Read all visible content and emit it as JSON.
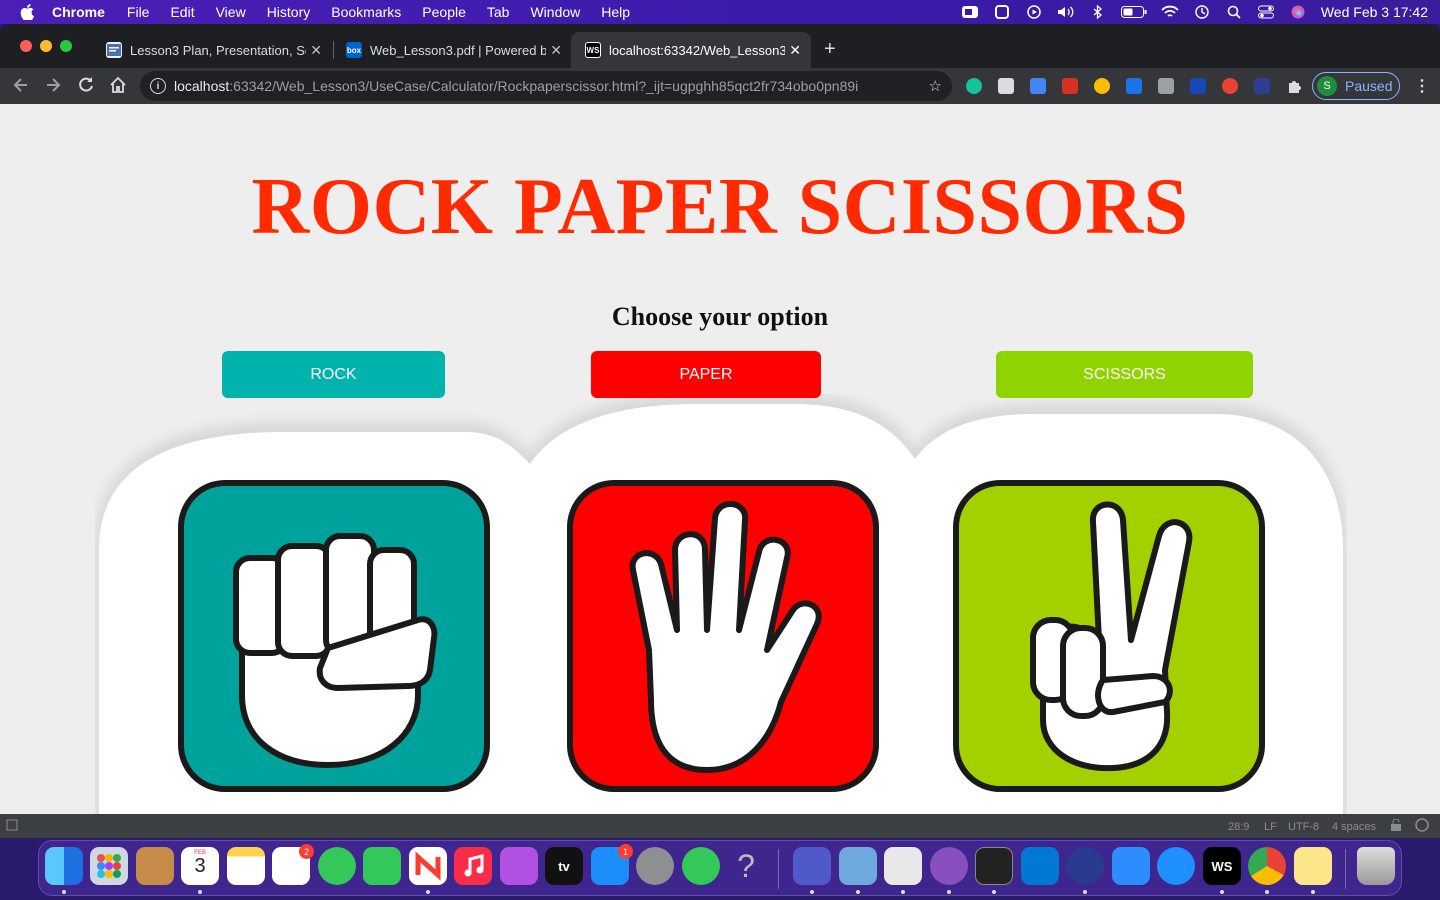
{
  "menubar": {
    "app": "Chrome",
    "items": [
      "File",
      "Edit",
      "View",
      "History",
      "Bookmarks",
      "People",
      "Tab",
      "Window",
      "Help"
    ],
    "clock": "Wed Feb 3  17:42"
  },
  "tabs": [
    {
      "title": "Lesson3 Plan, Presentation, So",
      "favicon": "doc-icon"
    },
    {
      "title": "Web_Lesson3.pdf | Powered b",
      "favicon": "box-icon"
    },
    {
      "title": "localhost:63342/Web_Lesson3",
      "favicon": "webstorm-icon",
      "active": true
    }
  ],
  "omnibox": {
    "host": "localhost",
    "path": ":63342/Web_Lesson3/UseCase/Calculator/Rockpaperscissor.html?_ijt=ugpghh85qct2fr734obo0pn89i"
  },
  "profile": {
    "initial": "S",
    "label": "Paused"
  },
  "page": {
    "title": "ROCK PAPER SCISSORS",
    "subtitle": "Choose your option",
    "buttons": [
      {
        "label": "ROCK",
        "color": "#00b3ad"
      },
      {
        "label": "PAPER",
        "color": "#ff0000"
      },
      {
        "label": "SCISSORS",
        "color": "#8fd400"
      }
    ],
    "cards": [
      {
        "name": "rock",
        "color": "#00a39c"
      },
      {
        "name": "paper",
        "color": "#ff0000"
      },
      {
        "name": "scissors",
        "color": "#a3d100"
      }
    ]
  },
  "statusbar": {
    "position": "28:9",
    "line_ending": "LF",
    "encoding": "UTF-8",
    "indent": "4 spaces"
  },
  "dock": {
    "calendar_month": "FEB",
    "calendar_day": "3",
    "reminders_badge": "2",
    "appstore_badge": "1",
    "webstorm_label": "WS",
    "appletv_label": "tv"
  }
}
